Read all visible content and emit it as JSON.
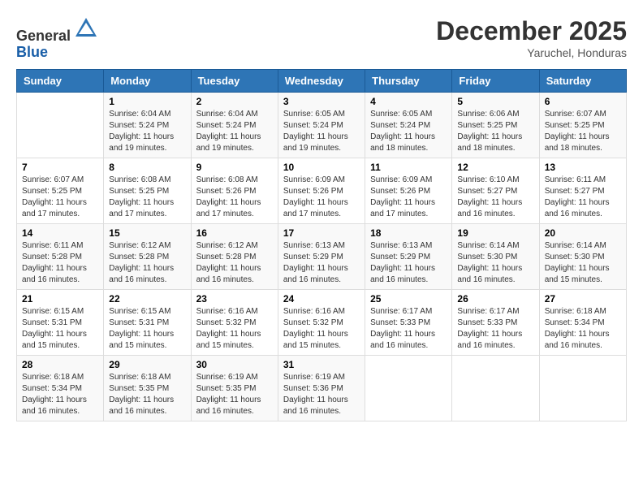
{
  "header": {
    "logo_line1": "General",
    "logo_line2": "Blue",
    "month": "December 2025",
    "location": "Yaruchel, Honduras"
  },
  "weekdays": [
    "Sunday",
    "Monday",
    "Tuesday",
    "Wednesday",
    "Thursday",
    "Friday",
    "Saturday"
  ],
  "weeks": [
    [
      {
        "day": "",
        "info": ""
      },
      {
        "day": "1",
        "info": "Sunrise: 6:04 AM\nSunset: 5:24 PM\nDaylight: 11 hours and 19 minutes."
      },
      {
        "day": "2",
        "info": "Sunrise: 6:04 AM\nSunset: 5:24 PM\nDaylight: 11 hours and 19 minutes."
      },
      {
        "day": "3",
        "info": "Sunrise: 6:05 AM\nSunset: 5:24 PM\nDaylight: 11 hours and 19 minutes."
      },
      {
        "day": "4",
        "info": "Sunrise: 6:05 AM\nSunset: 5:24 PM\nDaylight: 11 hours and 18 minutes."
      },
      {
        "day": "5",
        "info": "Sunrise: 6:06 AM\nSunset: 5:25 PM\nDaylight: 11 hours and 18 minutes."
      },
      {
        "day": "6",
        "info": "Sunrise: 6:07 AM\nSunset: 5:25 PM\nDaylight: 11 hours and 18 minutes."
      }
    ],
    [
      {
        "day": "7",
        "info": "Sunrise: 6:07 AM\nSunset: 5:25 PM\nDaylight: 11 hours and 17 minutes."
      },
      {
        "day": "8",
        "info": "Sunrise: 6:08 AM\nSunset: 5:25 PM\nDaylight: 11 hours and 17 minutes."
      },
      {
        "day": "9",
        "info": "Sunrise: 6:08 AM\nSunset: 5:26 PM\nDaylight: 11 hours and 17 minutes."
      },
      {
        "day": "10",
        "info": "Sunrise: 6:09 AM\nSunset: 5:26 PM\nDaylight: 11 hours and 17 minutes."
      },
      {
        "day": "11",
        "info": "Sunrise: 6:09 AM\nSunset: 5:26 PM\nDaylight: 11 hours and 17 minutes."
      },
      {
        "day": "12",
        "info": "Sunrise: 6:10 AM\nSunset: 5:27 PM\nDaylight: 11 hours and 16 minutes."
      },
      {
        "day": "13",
        "info": "Sunrise: 6:11 AM\nSunset: 5:27 PM\nDaylight: 11 hours and 16 minutes."
      }
    ],
    [
      {
        "day": "14",
        "info": "Sunrise: 6:11 AM\nSunset: 5:28 PM\nDaylight: 11 hours and 16 minutes."
      },
      {
        "day": "15",
        "info": "Sunrise: 6:12 AM\nSunset: 5:28 PM\nDaylight: 11 hours and 16 minutes."
      },
      {
        "day": "16",
        "info": "Sunrise: 6:12 AM\nSunset: 5:28 PM\nDaylight: 11 hours and 16 minutes."
      },
      {
        "day": "17",
        "info": "Sunrise: 6:13 AM\nSunset: 5:29 PM\nDaylight: 11 hours and 16 minutes."
      },
      {
        "day": "18",
        "info": "Sunrise: 6:13 AM\nSunset: 5:29 PM\nDaylight: 11 hours and 16 minutes."
      },
      {
        "day": "19",
        "info": "Sunrise: 6:14 AM\nSunset: 5:30 PM\nDaylight: 11 hours and 16 minutes."
      },
      {
        "day": "20",
        "info": "Sunrise: 6:14 AM\nSunset: 5:30 PM\nDaylight: 11 hours and 15 minutes."
      }
    ],
    [
      {
        "day": "21",
        "info": "Sunrise: 6:15 AM\nSunset: 5:31 PM\nDaylight: 11 hours and 15 minutes."
      },
      {
        "day": "22",
        "info": "Sunrise: 6:15 AM\nSunset: 5:31 PM\nDaylight: 11 hours and 15 minutes."
      },
      {
        "day": "23",
        "info": "Sunrise: 6:16 AM\nSunset: 5:32 PM\nDaylight: 11 hours and 15 minutes."
      },
      {
        "day": "24",
        "info": "Sunrise: 6:16 AM\nSunset: 5:32 PM\nDaylight: 11 hours and 15 minutes."
      },
      {
        "day": "25",
        "info": "Sunrise: 6:17 AM\nSunset: 5:33 PM\nDaylight: 11 hours and 16 minutes."
      },
      {
        "day": "26",
        "info": "Sunrise: 6:17 AM\nSunset: 5:33 PM\nDaylight: 11 hours and 16 minutes."
      },
      {
        "day": "27",
        "info": "Sunrise: 6:18 AM\nSunset: 5:34 PM\nDaylight: 11 hours and 16 minutes."
      }
    ],
    [
      {
        "day": "28",
        "info": "Sunrise: 6:18 AM\nSunset: 5:34 PM\nDaylight: 11 hours and 16 minutes."
      },
      {
        "day": "29",
        "info": "Sunrise: 6:18 AM\nSunset: 5:35 PM\nDaylight: 11 hours and 16 minutes."
      },
      {
        "day": "30",
        "info": "Sunrise: 6:19 AM\nSunset: 5:35 PM\nDaylight: 11 hours and 16 minutes."
      },
      {
        "day": "31",
        "info": "Sunrise: 6:19 AM\nSunset: 5:36 PM\nDaylight: 11 hours and 16 minutes."
      },
      {
        "day": "",
        "info": ""
      },
      {
        "day": "",
        "info": ""
      },
      {
        "day": "",
        "info": ""
      }
    ]
  ]
}
